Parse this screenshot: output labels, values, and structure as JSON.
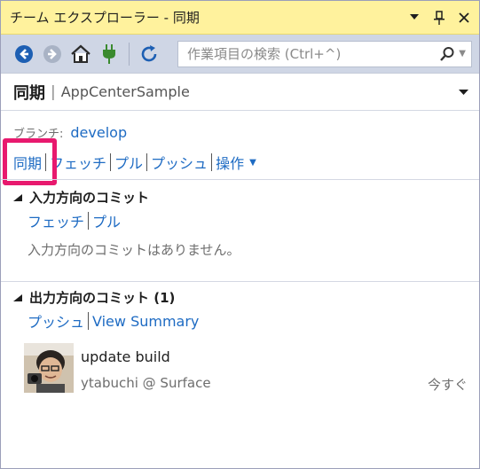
{
  "window": {
    "title": "チーム エクスプローラー - 同期",
    "pin_label": "ᚔ",
    "close_label": "✕",
    "menu_label": "▼"
  },
  "toolbar": {
    "search_placeholder": "作業項目の検索 (Ctrl+^)"
  },
  "header": {
    "page_title": "同期",
    "divider": "|",
    "repo_name": "AppCenterSample"
  },
  "branch": {
    "label": "ブランチ:",
    "name": "develop"
  },
  "nav": {
    "items": [
      "同期",
      "フェッチ",
      "プル",
      "プッシュ",
      "操作"
    ]
  },
  "incoming": {
    "title": "入力方向のコミット",
    "links": [
      "フェッチ",
      "プル"
    ],
    "empty_message": "入力方向のコミットはありません。"
  },
  "outgoing": {
    "title": "出力方向のコミット (1)",
    "links": [
      "プッシュ",
      "View Summary"
    ],
    "commits": [
      {
        "message": "update build",
        "author": "ytabuchi @ Surface",
        "time": "今すぐ"
      }
    ]
  },
  "colors": {
    "titlebar": "#fff29d",
    "toolbar": "#cfd6e5",
    "link": "#1e6bc3",
    "highlight": "#e8196e"
  }
}
